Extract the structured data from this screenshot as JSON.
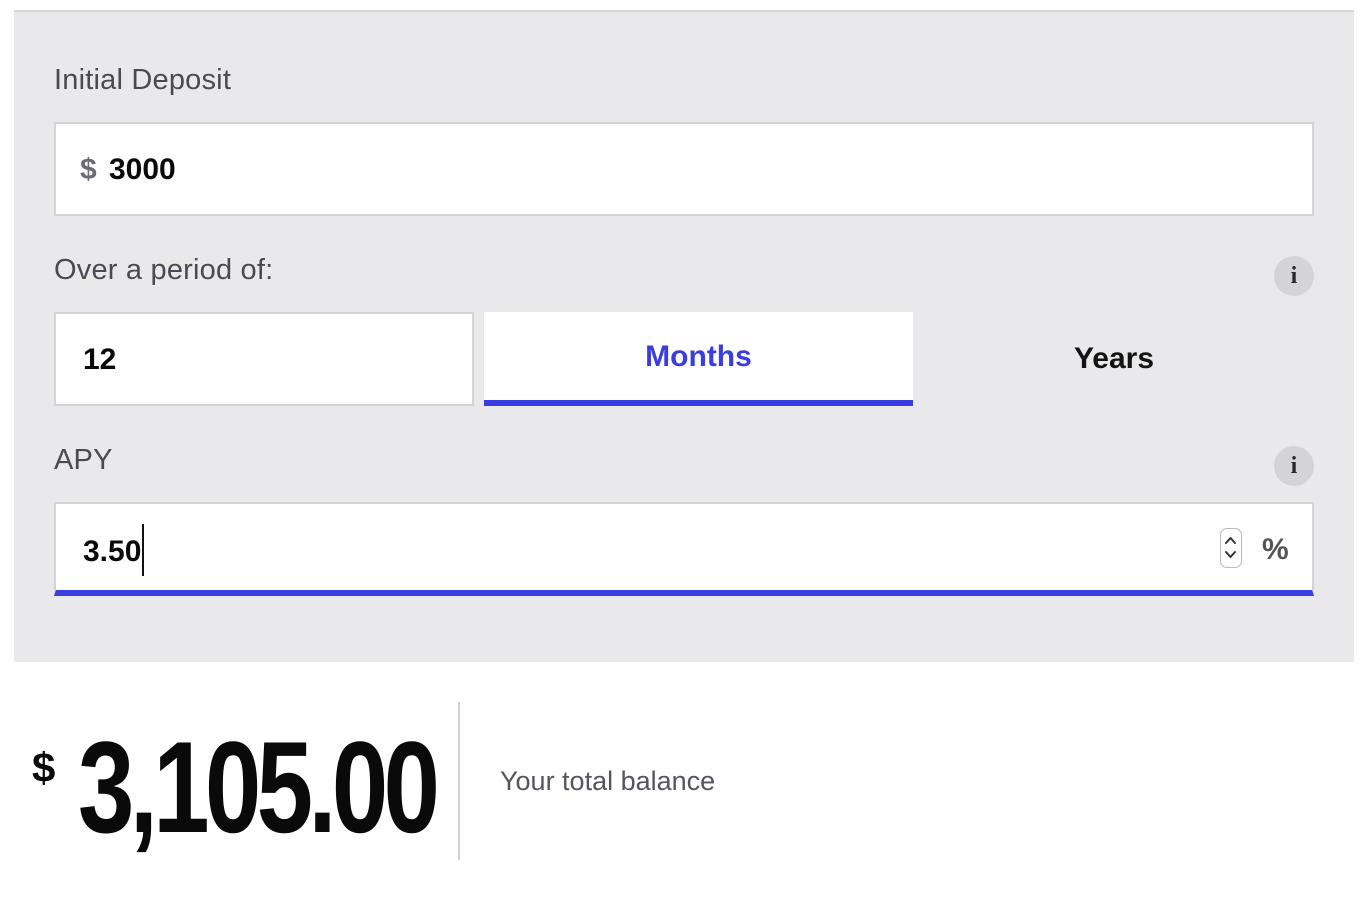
{
  "deposit": {
    "label": "Initial Deposit",
    "currency_symbol": "$",
    "value": "3000"
  },
  "period": {
    "label": "Over a period of:",
    "value": "12",
    "units": [
      "Months",
      "Years"
    ],
    "selected_unit": "Months",
    "info_icon": "i"
  },
  "apy": {
    "label": "APY",
    "value": "3.50",
    "suffix": "%",
    "info_icon": "i"
  },
  "result": {
    "currency_symbol": "$",
    "amount": "3,105.00",
    "label": "Your total balance"
  },
  "colors": {
    "accent": "#3a3de0",
    "panel_bg": "#e9e9eb",
    "text_dark": "#0a0a0a",
    "label_gray": "#4a4a52"
  },
  "icons": {
    "info": "info-icon",
    "stepper": "stepper-arrows-icon"
  }
}
